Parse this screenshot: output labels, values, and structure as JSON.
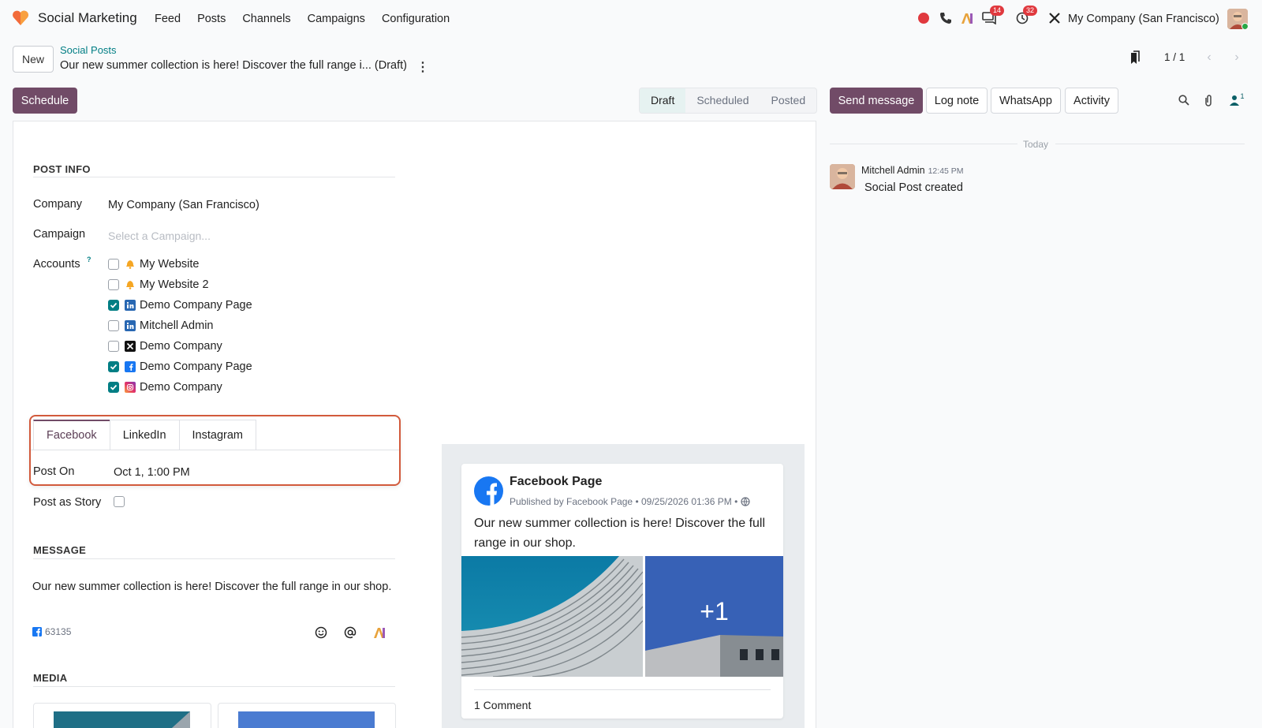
{
  "app": {
    "name": "Social Marketing",
    "menu": [
      "Feed",
      "Posts",
      "Channels",
      "Campaigns",
      "Configuration"
    ],
    "company": "My Company (San Francisco)",
    "badges": {
      "discuss": "14",
      "activity": "32"
    }
  },
  "breadcrumb": {
    "new_label": "New",
    "parent": "Social Posts",
    "title": "Our new summer collection is here! Discover the full range i... (Draft)",
    "pager": "1 / 1"
  },
  "actions": {
    "schedule_label": "Schedule",
    "status": [
      "Draft",
      "Scheduled",
      "Posted"
    ],
    "active_status": "Draft"
  },
  "chatter": {
    "buttons": [
      "Send message",
      "Log note",
      "WhatsApp",
      "Activity"
    ],
    "followers_count": "1",
    "date_separator": "Today",
    "message": {
      "author": "Mitchell Admin",
      "time": "12:45 PM",
      "body": "Social Post created"
    }
  },
  "form": {
    "post_info_title": "POST INFO",
    "company_label": "Company",
    "company_value": "My Company (San Francisco)",
    "campaign_label": "Campaign",
    "campaign_placeholder": "Select a Campaign...",
    "accounts_label": "Accounts",
    "help_mark": "?",
    "accounts": [
      {
        "name": "My Website",
        "icon": "bell-icon",
        "checked": false
      },
      {
        "name": "My Website 2",
        "icon": "bell-icon",
        "checked": false
      },
      {
        "name": "Demo Company Page",
        "icon": "linkedin-icon",
        "checked": true
      },
      {
        "name": "Mitchell Admin",
        "icon": "linkedin-icon",
        "checked": false
      },
      {
        "name": "Demo Company",
        "icon": "x-icon",
        "checked": false
      },
      {
        "name": "Demo Company Page",
        "icon": "facebook-icon",
        "checked": true
      },
      {
        "name": "Demo Company",
        "icon": "instagram-icon",
        "checked": true
      }
    ],
    "tabs": [
      "Facebook",
      "LinkedIn",
      "Instagram"
    ],
    "active_tab": "Facebook",
    "post_on_label": "Post On",
    "post_on_value": "Oct 1, 1:00 PM",
    "story_label": "Post as Story",
    "message_title": "MESSAGE",
    "message_text": "Our new summer collection is here! Discover the full range in our shop.",
    "fb_count": "63135",
    "media_title": "MEDIA"
  },
  "preview": {
    "page_name": "Facebook Page",
    "published": "Published by Facebook Page • 09/25/2026 01:36 PM •",
    "message": "Our new summer collection is here! Discover the full range in our shop.",
    "more_images": "+1",
    "comments": "1 Comment"
  },
  "colors": {
    "brand": "#714b67",
    "teal": "#017e84",
    "highlight": "#d25a3c",
    "facebook": "#1877f2"
  }
}
